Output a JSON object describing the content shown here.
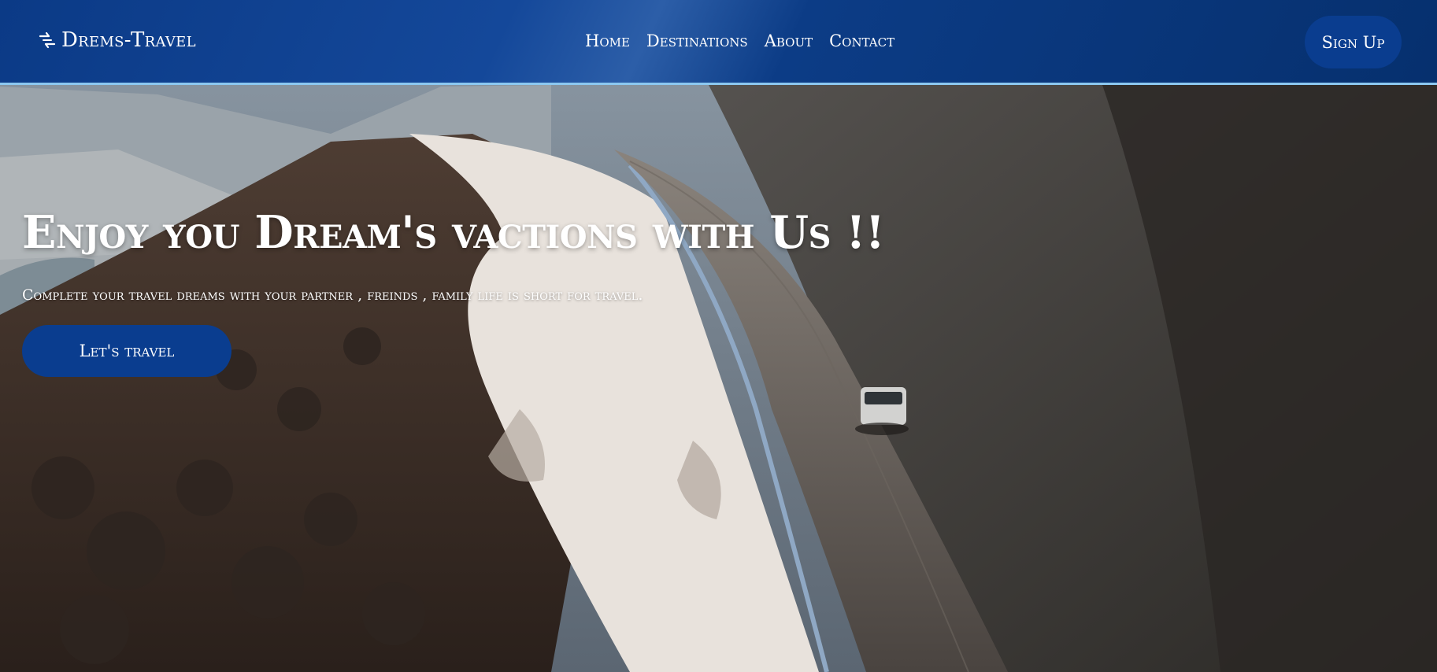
{
  "navbar": {
    "brand": {
      "icon": "plane-swap-icon",
      "label": "Drems-Travel"
    },
    "links": [
      {
        "label": "Home"
      },
      {
        "label": "Destinations"
      },
      {
        "label": "About"
      },
      {
        "label": "Contact"
      }
    ],
    "signup_label": "Sign Up"
  },
  "hero": {
    "title": "Enjoy you Dream's vactions with Us !!",
    "subtitle": "Complete your travel dreams with your partner , freinds , family life is short for travel.",
    "cta_label": "Let's travel",
    "background": "snowy-mountain-road-video"
  },
  "colors": {
    "nav_blue": "#0b3a86",
    "button_blue": "#0a3d8f",
    "nav_border": "#8cc8f0",
    "text": "#ffffff"
  }
}
